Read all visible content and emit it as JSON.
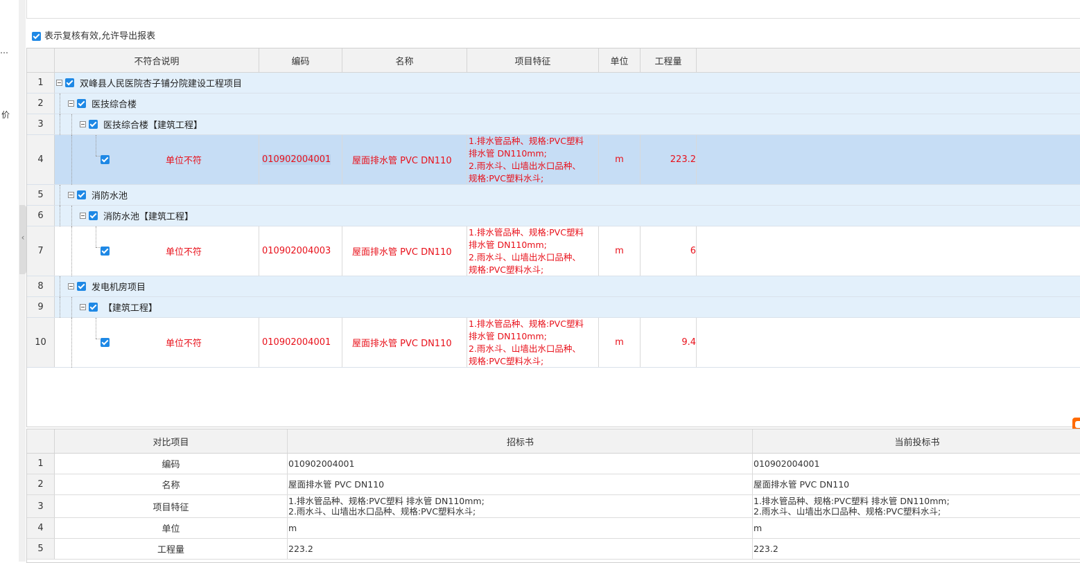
{
  "left_panel": {
    "text_top": "…",
    "text_mid": "价",
    "collapse_arrow": "‹"
  },
  "export_checkbox": {
    "checked": true,
    "label": "表示复核有效,允许导出报表"
  },
  "main_table": {
    "columns": [
      "不符合说明",
      "编码",
      "名称",
      "项目特征",
      "单位",
      "工程量"
    ],
    "rows": [
      {
        "num": "1",
        "type": "group",
        "label": "双峰县人民医院杏子铺分院建设工程项目"
      },
      {
        "num": "2",
        "type": "group",
        "label": "医技综合楼"
      },
      {
        "num": "3",
        "type": "group",
        "label": "医技综合楼【建筑工程】"
      },
      {
        "num": "4",
        "type": "item",
        "desc": "单位不符",
        "code": "010902004001",
        "name": "屋面排水管 PVC DN110",
        "feature_lines": [
          "1.排水管品种、规格:PVC塑料",
          "排水管 DN110mm;",
          "2.雨水斗、山墙出水口品种、",
          "规格:PVC塑料水斗;"
        ],
        "unit": "m",
        "qty": "223.2"
      },
      {
        "num": "5",
        "type": "group",
        "label": "消防水池"
      },
      {
        "num": "6",
        "type": "group",
        "label": "消防水池【建筑工程】"
      },
      {
        "num": "7",
        "type": "item",
        "desc": "单位不符",
        "code": "010902004003",
        "name": "屋面排水管 PVC DN110",
        "feature_lines": [
          "1.排水管品种、规格:PVC塑料",
          "排水管 DN110mm;",
          "2.雨水斗、山墙出水口品种、",
          "规格:PVC塑料水斗;"
        ],
        "unit": "m",
        "qty": "6"
      },
      {
        "num": "8",
        "type": "group",
        "label": "发电机房项目"
      },
      {
        "num": "9",
        "type": "group",
        "label": "【建筑工程】"
      },
      {
        "num": "10",
        "type": "item",
        "desc": "单位不符",
        "code": "010902004001",
        "name": "屋面排水管 PVC DN110",
        "feature_lines": [
          "1.排水管品种、规格:PVC塑料",
          "排水管 DN110mm;",
          "2.雨水斗、山墙出水口品种、",
          "规格:PVC塑料水斗;"
        ],
        "unit": "m",
        "qty": "9.4"
      }
    ]
  },
  "compare_table": {
    "columns": [
      "对比项目",
      "招标书",
      "当前投标书"
    ],
    "rows": [
      {
        "num": "1",
        "item": "编码",
        "tender_lines": [
          "010902004001"
        ],
        "bid_lines": [
          "010902004001"
        ]
      },
      {
        "num": "2",
        "item": "名称",
        "tender_lines": [
          "屋面排水管 PVC DN110"
        ],
        "bid_lines": [
          "屋面排水管 PVC DN110"
        ]
      },
      {
        "num": "3",
        "item": "项目特征",
        "tender_lines": [
          "1.排水管品种、规格:PVC塑料 排水管 DN110mm;",
          "2.雨水斗、山墙出水口品种、规格:PVC塑料水斗;"
        ],
        "bid_lines": [
          "1.排水管品种、规格:PVC塑料 排水管 DN110mm;",
          "2.雨水斗、山墙出水口品种、规格:PVC塑料水斗;"
        ]
      },
      {
        "num": "4",
        "item": "单位",
        "tender_lines": [
          "m"
        ],
        "bid_lines": [
          "m"
        ]
      },
      {
        "num": "5",
        "item": "工程量",
        "tender_lines": [
          "223.2"
        ],
        "bid_lines": [
          "223.2"
        ]
      }
    ]
  },
  "colors": {
    "error_text": "#e8101a",
    "group_row": "#e3f0fb",
    "selected_row": "#c6ddf5",
    "checkbox": "#1e88e5"
  }
}
